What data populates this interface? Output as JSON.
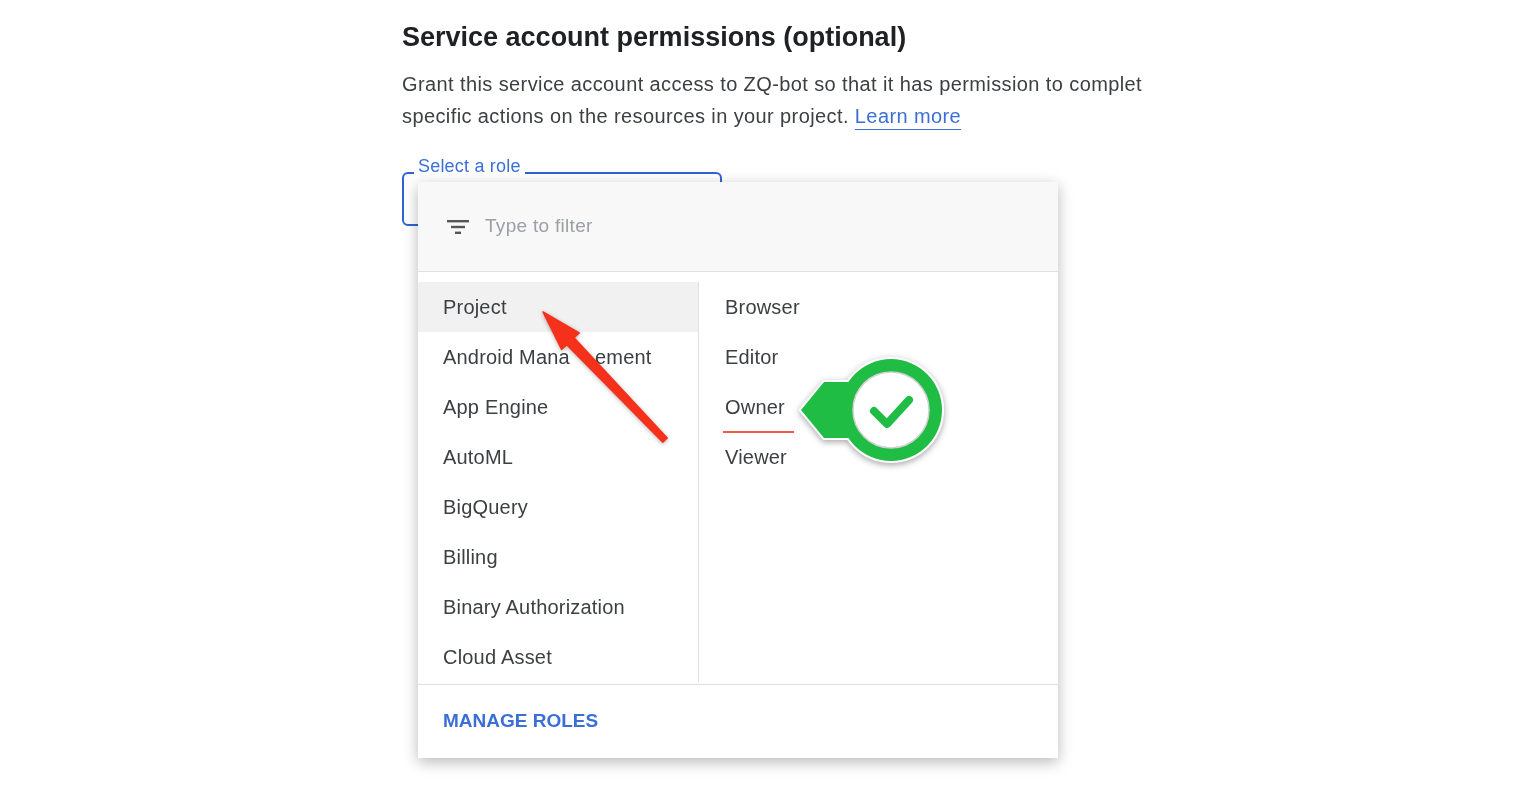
{
  "heading": "Service account permissions (optional)",
  "description": {
    "lines": [
      "Grant this service account access to ZQ-bot so that it has permission to complet",
      "specific actions on the resources in your project."
    ],
    "link": "Learn more"
  },
  "role_select": {
    "label": "Select a role"
  },
  "role_menu": {
    "filter": {
      "placeholder": "Type to filter"
    },
    "categories": [
      {
        "label": "Project",
        "selected": true,
        "arrow": true
      },
      {
        "label_parts": [
          "Android Mana",
          "ement"
        ],
        "selected": false,
        "arrow": false
      },
      {
        "label": "App Engine",
        "selected": false,
        "arrow": false
      },
      {
        "label": "AutoML",
        "selected": false,
        "arrow": false
      },
      {
        "label": "BigQuery",
        "selected": false,
        "arrow": false
      },
      {
        "label": "Billing",
        "selected": false,
        "arrow": false
      },
      {
        "label": "Binary Authorization",
        "selected": false,
        "arrow": false
      },
      {
        "label": "Cloud Asset",
        "selected": false,
        "arrow": false
      }
    ],
    "roles": [
      {
        "label": "Browser",
        "marked": false
      },
      {
        "label": "Editor",
        "marked": false
      },
      {
        "label": "Owner",
        "marked": true
      },
      {
        "label": "Viewer",
        "marked": false
      }
    ],
    "footer_button": "MANAGE ROLES"
  }
}
